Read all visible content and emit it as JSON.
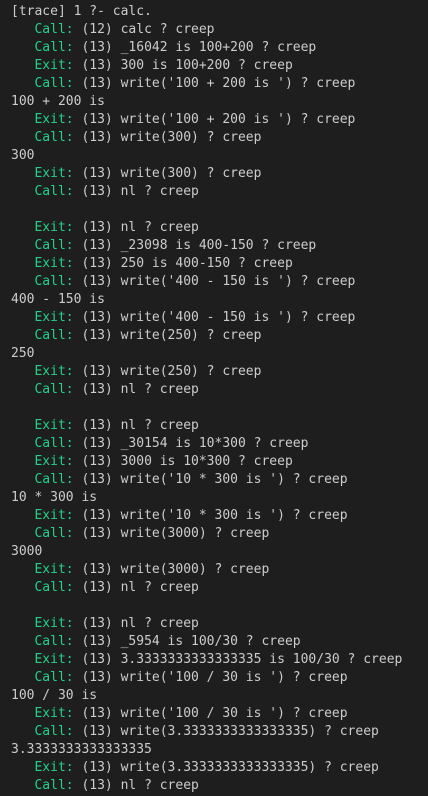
{
  "colors": {
    "background": "#1e1e1e",
    "text": "#cccccc",
    "port": "#23d18b"
  },
  "lines": [
    {
      "type": "text",
      "text": "[trace] 1 ?- calc."
    },
    {
      "type": "trace",
      "port": "Call:",
      "text": " (12) calc ? creep"
    },
    {
      "type": "trace",
      "port": "Call:",
      "text": " (13) _16042 is 100+200 ? creep"
    },
    {
      "type": "trace",
      "port": "Exit:",
      "text": " (13) 300 is 100+200 ? creep"
    },
    {
      "type": "trace",
      "port": "Call:",
      "text": " (13) write('100 + 200 is ') ? creep"
    },
    {
      "type": "text",
      "text": "100 + 200 is"
    },
    {
      "type": "trace",
      "port": "Exit:",
      "text": " (13) write('100 + 200 is ') ? creep"
    },
    {
      "type": "trace",
      "port": "Call:",
      "text": " (13) write(300) ? creep"
    },
    {
      "type": "text",
      "text": "300"
    },
    {
      "type": "trace",
      "port": "Exit:",
      "text": " (13) write(300) ? creep"
    },
    {
      "type": "trace",
      "port": "Call:",
      "text": " (13) nl ? creep"
    },
    {
      "type": "text",
      "text": ""
    },
    {
      "type": "trace",
      "port": "Exit:",
      "text": " (13) nl ? creep"
    },
    {
      "type": "trace",
      "port": "Call:",
      "text": " (13) _23098 is 400-150 ? creep"
    },
    {
      "type": "trace",
      "port": "Exit:",
      "text": " (13) 250 is 400-150 ? creep"
    },
    {
      "type": "trace",
      "port": "Call:",
      "text": " (13) write('400 - 150 is ') ? creep"
    },
    {
      "type": "text",
      "text": "400 - 150 is"
    },
    {
      "type": "trace",
      "port": "Exit:",
      "text": " (13) write('400 - 150 is ') ? creep"
    },
    {
      "type": "trace",
      "port": "Call:",
      "text": " (13) write(250) ? creep"
    },
    {
      "type": "text",
      "text": "250"
    },
    {
      "type": "trace",
      "port": "Exit:",
      "text": " (13) write(250) ? creep"
    },
    {
      "type": "trace",
      "port": "Call:",
      "text": " (13) nl ? creep"
    },
    {
      "type": "text",
      "text": ""
    },
    {
      "type": "trace",
      "port": "Exit:",
      "text": " (13) nl ? creep"
    },
    {
      "type": "trace",
      "port": "Call:",
      "text": " (13) _30154 is 10*300 ? creep"
    },
    {
      "type": "trace",
      "port": "Exit:",
      "text": " (13) 3000 is 10*300 ? creep"
    },
    {
      "type": "trace",
      "port": "Call:",
      "text": " (13) write('10 * 300 is ') ? creep"
    },
    {
      "type": "text",
      "text": "10 * 300 is"
    },
    {
      "type": "trace",
      "port": "Exit:",
      "text": " (13) write('10 * 300 is ') ? creep"
    },
    {
      "type": "trace",
      "port": "Call:",
      "text": " (13) write(3000) ? creep"
    },
    {
      "type": "text",
      "text": "3000"
    },
    {
      "type": "trace",
      "port": "Exit:",
      "text": " (13) write(3000) ? creep"
    },
    {
      "type": "trace",
      "port": "Call:",
      "text": " (13) nl ? creep"
    },
    {
      "type": "text",
      "text": ""
    },
    {
      "type": "trace",
      "port": "Exit:",
      "text": " (13) nl ? creep"
    },
    {
      "type": "trace",
      "port": "Call:",
      "text": " (13) _5954 is 100/30 ? creep"
    },
    {
      "type": "trace",
      "port": "Exit:",
      "text": " (13) 3.3333333333333335 is 100/30 ? creep"
    },
    {
      "type": "trace",
      "port": "Call:",
      "text": " (13) write('100 / 30 is ') ? creep"
    },
    {
      "type": "text",
      "text": "100 / 30 is"
    },
    {
      "type": "trace",
      "port": "Exit:",
      "text": " (13) write('100 / 30 is ') ? creep"
    },
    {
      "type": "trace",
      "port": "Call:",
      "text": " (13) write(3.3333333333333335) ? creep"
    },
    {
      "type": "text",
      "text": "3.3333333333333335"
    },
    {
      "type": "trace",
      "port": "Exit:",
      "text": " (13) write(3.3333333333333335) ? creep"
    },
    {
      "type": "trace",
      "port": "Call:",
      "text": " (13) nl ? creep"
    }
  ]
}
